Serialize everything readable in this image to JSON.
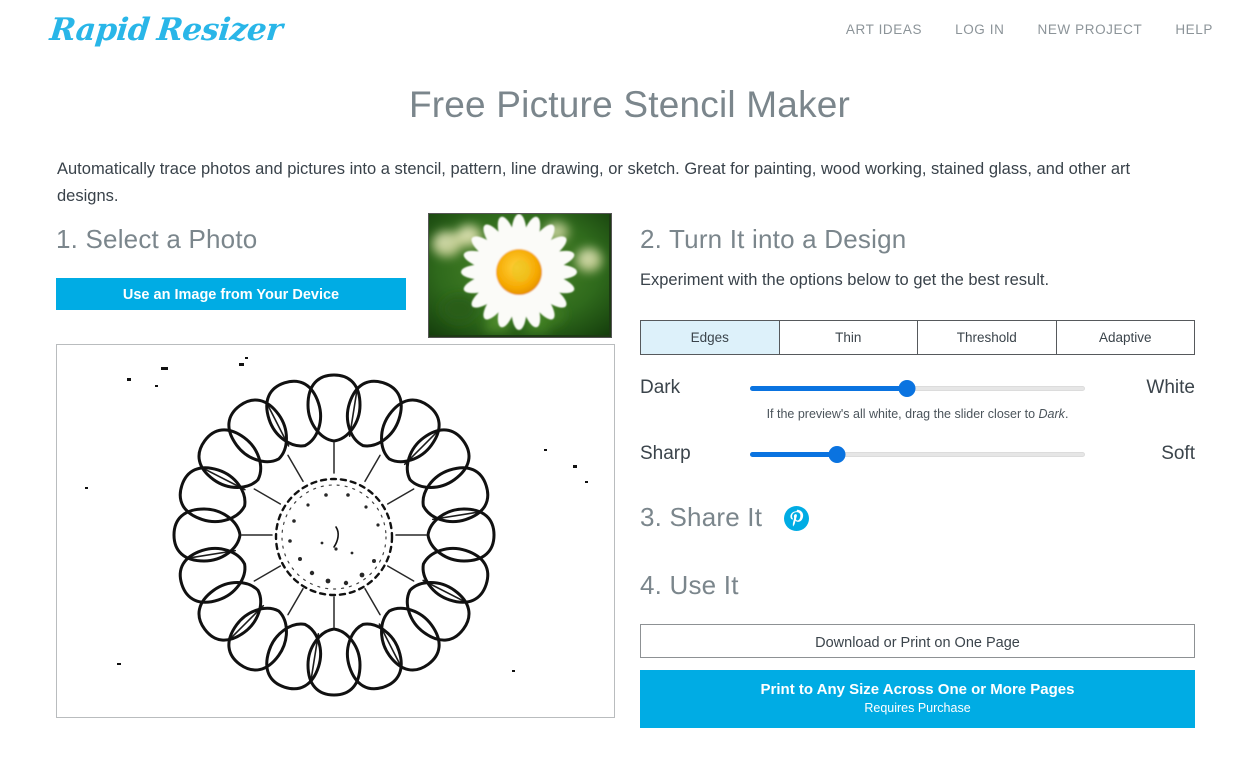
{
  "header": {
    "logo_word1": "Rapid",
    "logo_word2": "Resizer",
    "logo_color": "#29b6e8",
    "nav": [
      {
        "label": "ART IDEAS",
        "name": "nav-art-ideas"
      },
      {
        "label": "LOG IN",
        "name": "nav-log-in"
      },
      {
        "label": "NEW PROJECT",
        "name": "nav-new-project"
      },
      {
        "label": "HELP",
        "name": "nav-help"
      }
    ]
  },
  "page": {
    "title": "Free Picture Stencil Maker",
    "intro": "Automatically trace photos and pictures into a stencil, pattern, line drawing, or sketch. Great for painting, wood working, stained glass, and other art designs."
  },
  "step1": {
    "heading": "1. Select a Photo",
    "button_label": "Use an Image from Your Device",
    "button_color": "#00ace4",
    "thumbnail_alt": "white daisy flower photo thumbnail",
    "preview_alt": "black and white daisy stencil line drawing preview"
  },
  "step2": {
    "heading": "2. Turn It into a Design",
    "subtitle": "Experiment with the options below to get the best result.",
    "tabs": [
      {
        "label": "Edges",
        "active": true
      },
      {
        "label": "Thin",
        "active": false
      },
      {
        "label": "Threshold",
        "active": false
      },
      {
        "label": "Adaptive",
        "active": false
      }
    ],
    "active_tab_color": "#ddf1fa",
    "slider1": {
      "left_label": "Dark",
      "right_label": "White",
      "value_percent": 47,
      "hint_prefix": "If the preview's all white, drag the slider closer to ",
      "hint_emphasis": "Dark",
      "hint_suffix": ".",
      "fill_color": "#0a73e0"
    },
    "slider2": {
      "left_label": "Sharp",
      "right_label": "Soft",
      "value_percent": 26,
      "fill_color": "#0a73e0"
    }
  },
  "step3": {
    "heading": "3. Share It",
    "share_icon": "pinterest-icon",
    "share_icon_color": "#00ace4"
  },
  "step4": {
    "heading": "4. Use It",
    "download_label": "Download or Print on One Page",
    "print_label": "Print to Any Size Across One or More Pages",
    "print_sublabel": "Requires Purchase",
    "print_color": "#00ace4"
  }
}
